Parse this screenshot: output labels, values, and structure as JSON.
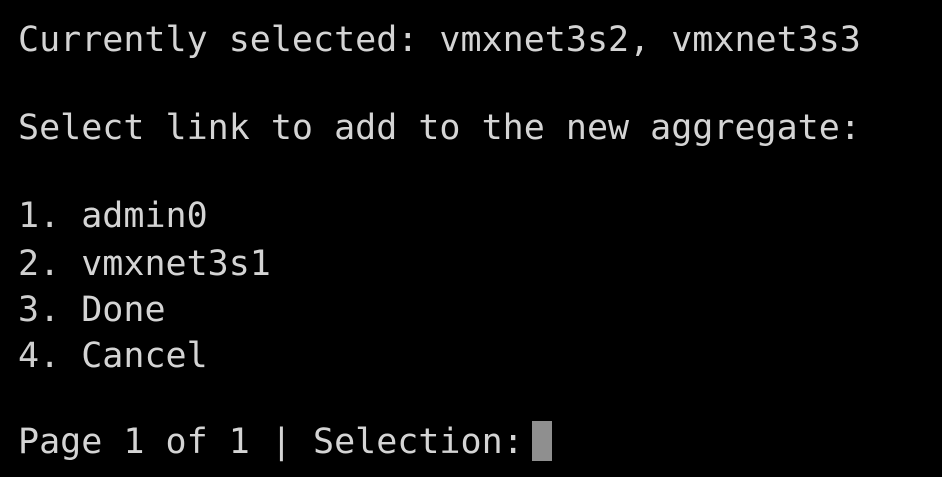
{
  "terminal": {
    "current_selection": "Currently selected: vmxnet3s2, vmxnet3s3",
    "prompt": "Select link to add to the new aggregate:",
    "options": [
      {
        "number": "1.",
        "label": "admin0"
      },
      {
        "number": "2.",
        "label": "vmxnet3s1"
      },
      {
        "number": "3.",
        "label": "Done"
      },
      {
        "number": "4.",
        "label": "Cancel"
      }
    ],
    "status": "Page 1 of 1 | Selection:",
    "input_value": ""
  },
  "colors": {
    "background": "#000000",
    "text": "#d4d4d4",
    "cursor": "#8f8f8f"
  }
}
